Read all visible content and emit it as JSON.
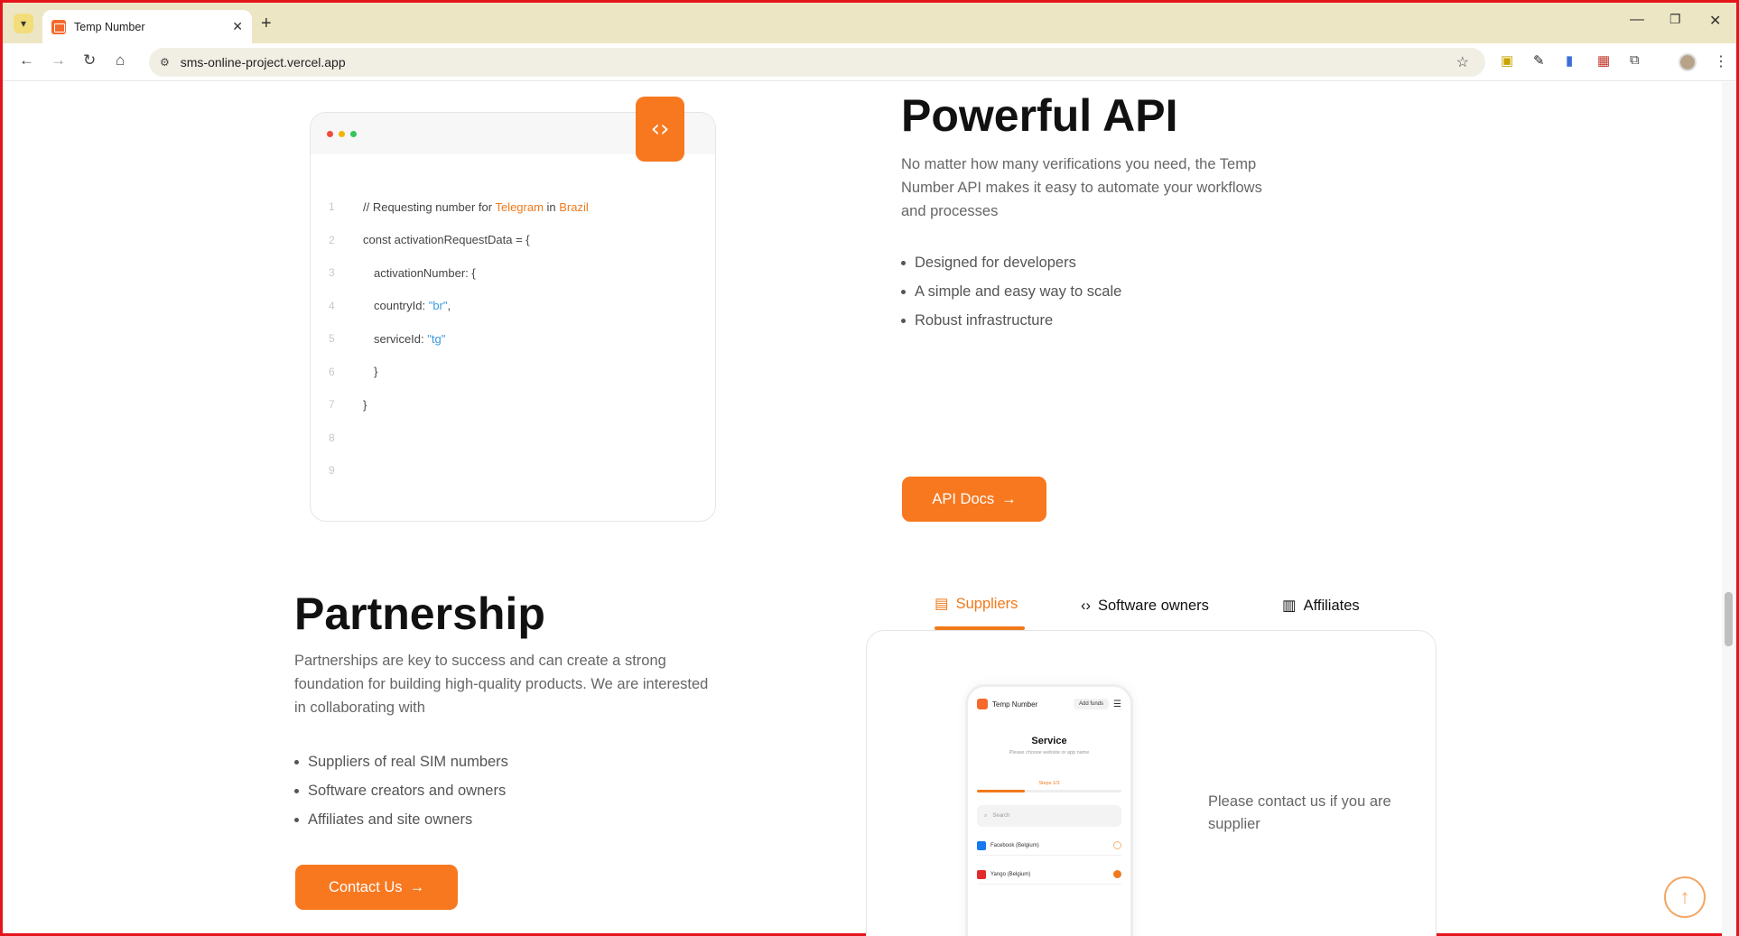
{
  "browser": {
    "tab_title": "Temp Number",
    "url": "sms-online-project.vercel.app"
  },
  "code_sample": {
    "lines": [
      {
        "num": "1",
        "parts": [
          [
            "// Requesting number for ",
            ""
          ],
          [
            "Telegram",
            "orange"
          ],
          [
            " in ",
            ""
          ],
          [
            "Brazil",
            "orange"
          ]
        ],
        "indent": 0
      },
      {
        "num": "2",
        "parts": [
          [
            "const activationRequestData = {",
            ""
          ]
        ],
        "indent": 0
      },
      {
        "num": "3",
        "parts": [
          [
            "activationNumber: {",
            ""
          ]
        ],
        "indent": 1
      },
      {
        "num": "4",
        "parts": [
          [
            "countryId: ",
            ""
          ],
          [
            "\"br\"",
            "blue"
          ],
          [
            ",",
            ""
          ]
        ],
        "indent": 1
      },
      {
        "num": "5",
        "parts": [
          [
            "serviceId: ",
            ""
          ],
          [
            "\"tg\"",
            "blue"
          ]
        ],
        "indent": 1
      },
      {
        "num": "6",
        "parts": [
          [
            "}",
            ""
          ]
        ],
        "indent": 1
      },
      {
        "num": "7",
        "parts": [
          [
            "}",
            ""
          ]
        ],
        "indent": 0
      },
      {
        "num": "8",
        "parts": [],
        "indent": 0
      },
      {
        "num": "9",
        "parts": [],
        "indent": 0
      }
    ],
    "badge_icon": "code-icon"
  },
  "api": {
    "title": "Powerful API",
    "description": "No matter how many verifications you need, the Temp Number API makes it easy to automate your workflows and processes",
    "features": [
      "Designed for developers",
      "A simple and easy way to scale",
      "Robust infrastructure"
    ],
    "button_label": "API Docs"
  },
  "partnership": {
    "title": "Partnership",
    "description": "Partnerships are key to success and can create a strong foundation for building high-quality products. We are interested in collaborating with",
    "items": [
      "Suppliers of real SIM numbers",
      "Software creators and owners",
      "Affiliates and site owners"
    ],
    "button_label": "Contact Us",
    "tabs": [
      {
        "label": "Suppliers",
        "icon": "store-icon",
        "active": true
      },
      {
        "label": "Software owners",
        "icon": "code-icon",
        "active": false
      },
      {
        "label": "Affiliates",
        "icon": "building-icon",
        "active": false
      }
    ],
    "panel_text": "Please contact us if you are supplier"
  },
  "phone_mock": {
    "brand": "Temp Number",
    "add_funds": "Add funds",
    "service_title": "Service",
    "service_sub": "Please choose website or app name",
    "steps": "Steps 1/3",
    "progress": 0.33,
    "search_placeholder": "Search",
    "items": [
      "Facebook (Belgium)",
      "Yango (Belgium)"
    ]
  },
  "colors": {
    "accent": "#f7781f",
    "tab_bar": "#ece6c4"
  }
}
